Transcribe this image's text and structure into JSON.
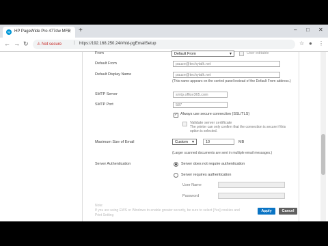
{
  "browser": {
    "tab_title": "HP PageWide Pro 477dw MFP",
    "tab_favicon": "hp",
    "new_tab": "+",
    "win_min": "–",
    "win_max": "□",
    "win_close": "✕",
    "security_label": "Not secure",
    "url": "https://192.168.250.24/#hId-pgEmailSetup",
    "back": "←",
    "forward": "→",
    "reload": "↻"
  },
  "form": {
    "from_label": "From",
    "from_select": "Default From",
    "user_editable_label": "User editable",
    "default_from_label": "Default From",
    "default_from_value": "pauze@techytalk.net",
    "display_name_label": "Default Display Name",
    "display_name_value": "pauze@techytalk.net",
    "display_name_note": "(This name appears on the control panel instead of the Default From address.)",
    "smtp_server_label": "SMTP Server",
    "smtp_server_value": "smtp.office365.com",
    "smtp_port_label": "SMTP Port",
    "smtp_port_value": "587",
    "ssl_label": "Always use secure connection (SSL/TLS)",
    "validate_label": "Validate server certificate",
    "validate_note": "The printer can only confirm that the connection is secure if this option is selected.",
    "max_size_label": "Maximum Size of Email",
    "max_size_select": "Custom",
    "max_size_value": "10",
    "max_size_unit": "MB",
    "max_size_note": "(Larger scanned documents are sent in multiple email messages.)",
    "auth_label": "Server Authentication",
    "auth_opt1": "Server does not require authentication",
    "auth_opt2": "Server requires authentication",
    "username_label": "User Name",
    "password_label": "Password",
    "note_title": "Note:",
    "note_text": "If you are using EWS or Windows to enable greater security, be sure to select [Yes] cookies and",
    "note_text2": "Print Setting",
    "apply": "Apply",
    "cancel": "Cancel"
  },
  "colors": {
    "apply_bg": "#0a74c4",
    "cancel_bg": "#5f5f5f"
  }
}
